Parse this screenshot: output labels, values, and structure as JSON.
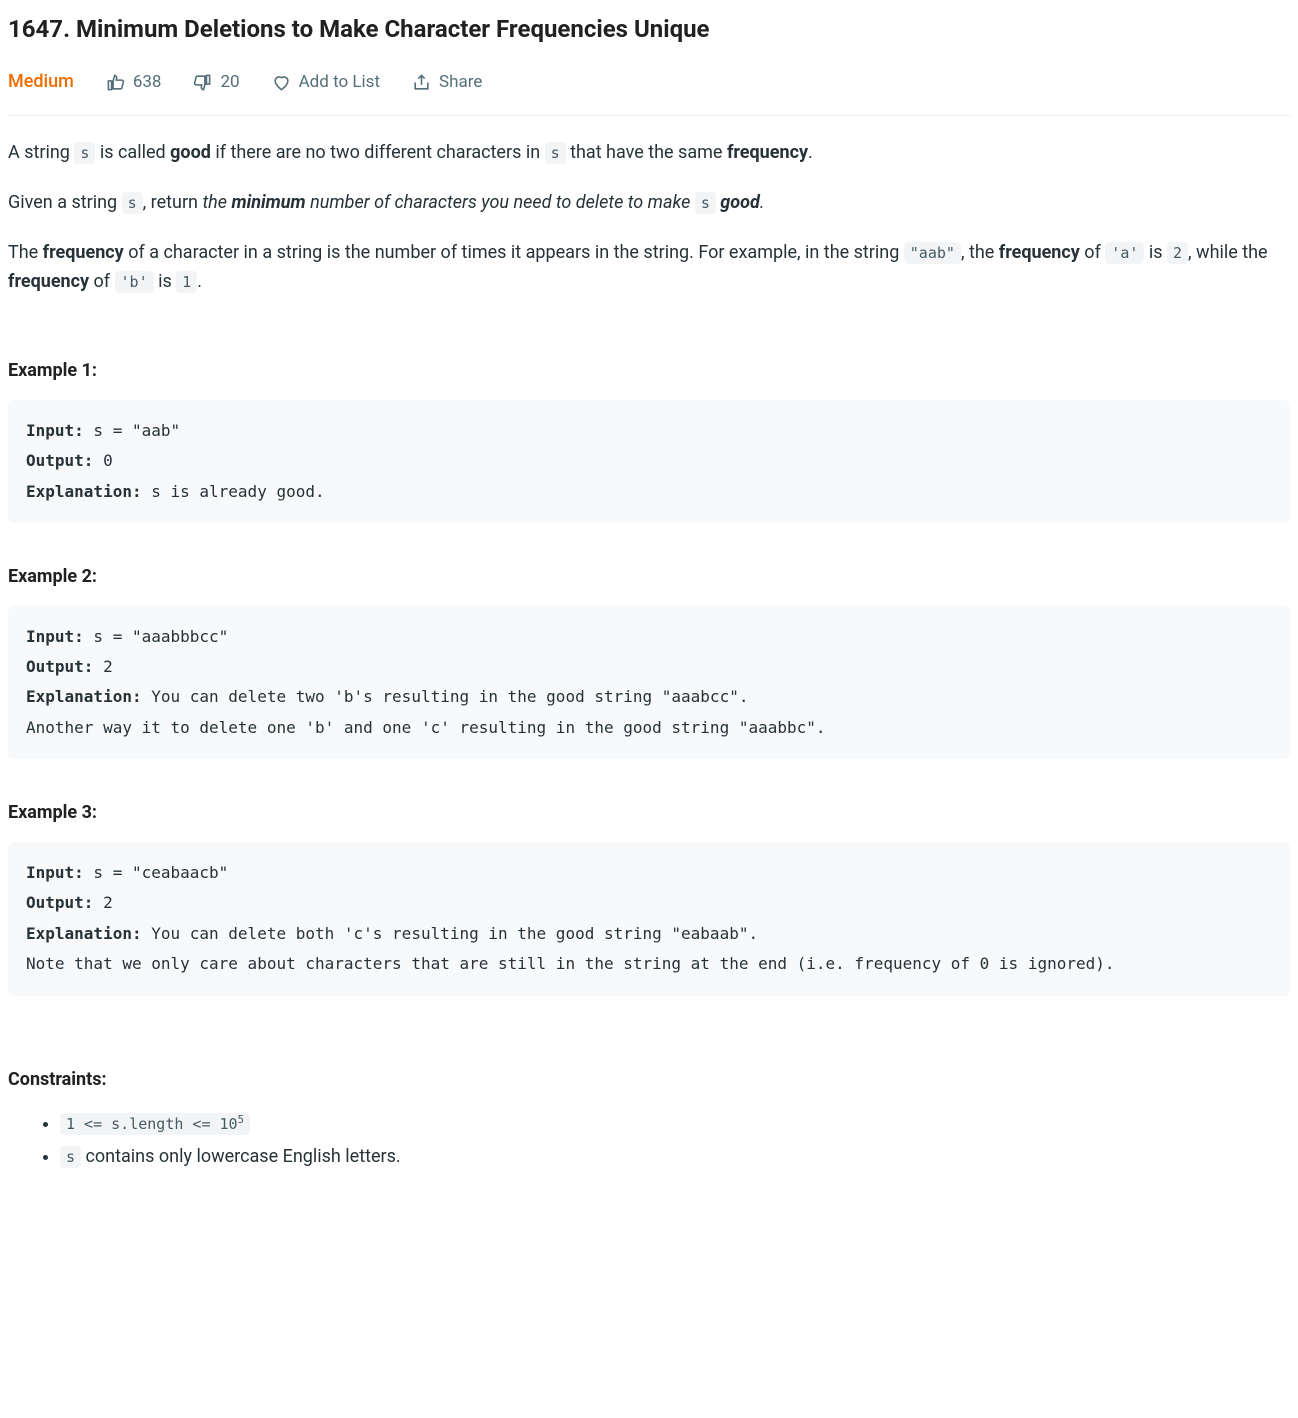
{
  "problem": {
    "number": "1647",
    "title": "Minimum Deletions to Make Character Frequencies Unique",
    "full_title": "1647. Minimum Deletions to Make Character Frequencies Unique",
    "difficulty": "Medium"
  },
  "meta": {
    "likes": "638",
    "dislikes": "20",
    "add_to_list": "Add to List",
    "share": "Share"
  },
  "desc": {
    "p1_a": "A string ",
    "p1_code1": "s",
    "p1_b": " is called ",
    "p1_bold1": "good",
    "p1_c": " if there are no two different characters in ",
    "p1_code2": "s",
    "p1_d": " that have the same ",
    "p1_bold2": "frequency",
    "p1_e": ".",
    "p2_a": "Given a string ",
    "p2_code1": "s",
    "p2_b": ", return ",
    "p2_em1": "the ",
    "p2_em_bold": "minimum",
    "p2_em2": " number of characters you need to delete to make ",
    "p2_code2": "s",
    "p2_em3": " ",
    "p2_em_bold2": "good",
    "p2_em4": ".",
    "p3_a": "The ",
    "p3_bold1": "frequency",
    "p3_b": " of a character in a string is the number of times it appears in the string. For example, in the string ",
    "p3_code1": "\"aab\"",
    "p3_c": ", the ",
    "p3_bold2": "frequency",
    "p3_d": " of ",
    "p3_code2": "'a'",
    "p3_e": " is ",
    "p3_code3": "2",
    "p3_f": ", while the ",
    "p3_bold3": "frequency",
    "p3_g": " of ",
    "p3_code4": "'b'",
    "p3_h": " is ",
    "p3_code5": "1",
    "p3_i": "."
  },
  "examples": {
    "h1": "Example 1:",
    "h2": "Example 2:",
    "h3": "Example 3:",
    "input_label": "Input:",
    "output_label": "Output:",
    "explanation_label": "Explanation:",
    "ex1_input": " s = \"aab\"",
    "ex1_output": " 0",
    "ex1_explanation": " s is already good.",
    "ex2_input": " s = \"aaabbbcc\"",
    "ex2_output": " 2",
    "ex2_explanation": " You can delete two 'b's resulting in the good string \"aaabcc\".\nAnother way it to delete one 'b' and one 'c' resulting in the good string \"aaabbc\".",
    "ex3_input": " s = \"ceabaacb\"",
    "ex3_output": " 2",
    "ex3_explanation": " You can delete both 'c's resulting in the good string \"eabaab\".\nNote that we only care about characters that are still in the string at the end (i.e. frequency of 0 is ignored)."
  },
  "constraints": {
    "heading": "Constraints:",
    "c1_a": "1 <= s.length <= 10",
    "c1_sup": "5",
    "c2_code": "s",
    "c2_text": " contains only lowercase English letters."
  }
}
